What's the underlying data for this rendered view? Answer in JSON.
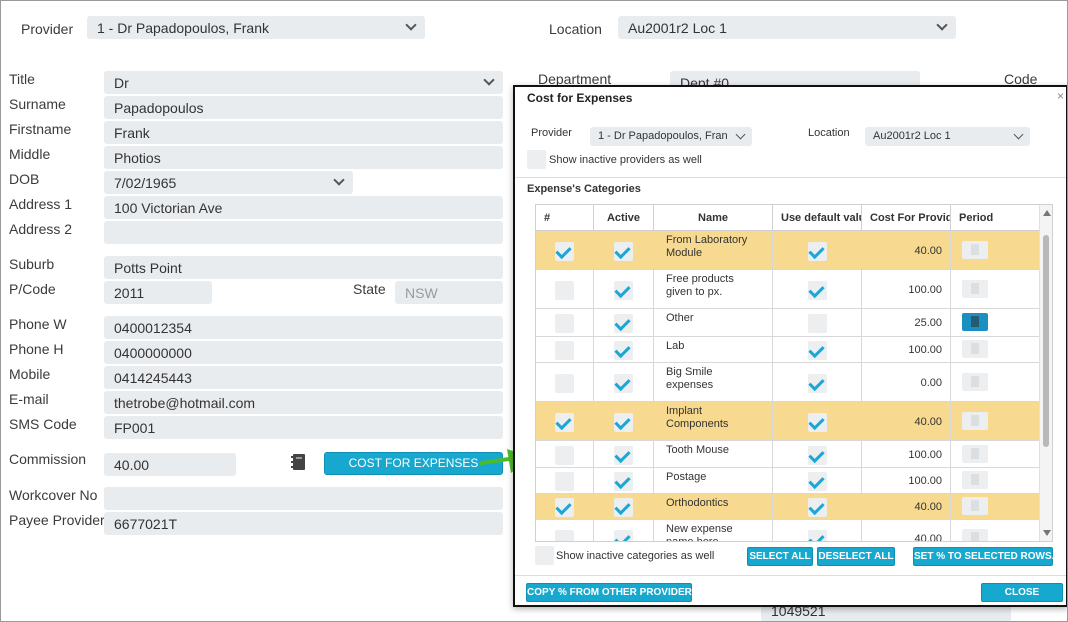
{
  "header": {
    "provider_label": "Provider",
    "provider_value": "1 - Dr Papadopoulos, Frank",
    "location_label": "Location",
    "location_value": "Au2001r2 Loc 1"
  },
  "form": {
    "title_label": "Title",
    "title_value": "Dr",
    "surname_label": "Surname",
    "surname_value": "Papadopoulos",
    "firstname_label": "Firstname",
    "firstname_value": "Frank",
    "middle_label": "Middle",
    "middle_value": "Photios",
    "dob_label": "DOB",
    "dob_value": "7/02/1965",
    "address1_label": "Address 1",
    "address1_value": "100 Victorian Ave",
    "address2_label": "Address 2",
    "address2_value": "",
    "suburb_label": "Suburb",
    "suburb_value": "Potts Point",
    "pcode_label": "P/Code",
    "pcode_value": "2011",
    "state_label": "State",
    "state_value": "NSW",
    "phonew_label": "Phone W",
    "phonew_value": "0400012354",
    "phoneh_label": "Phone H",
    "phoneh_value": "0400000000",
    "mobile_label": "Mobile",
    "mobile_value": "0414245443",
    "email_label": "E-mail",
    "email_value": "thetrobe@hotmail.com",
    "sms_label": "SMS Code",
    "sms_value": "FP001",
    "commission_label": "Commission",
    "commission_value": "40.00",
    "cost_button": "COST FOR EXPENSES",
    "workcover_label": "Workcover No",
    "workcover_value": "",
    "payee_label": "Payee Provider",
    "payee_value": "6677021T"
  },
  "right_bg": {
    "department_label": "Department",
    "department_value": "Dept #0",
    "code_label": "Code",
    "bottom_value": "1049521"
  },
  "modal": {
    "title": "Cost for Expenses",
    "close": "×",
    "provider_label": "Provider",
    "provider_value": "1 - Dr Papadopoulos, Fran",
    "location_label": "Location",
    "location_value": "Au2001r2 Loc 1",
    "show_inactive_providers": "Show inactive providers as well",
    "section_title": "Expense's Categories",
    "columns": [
      "#",
      "Active",
      "Name",
      "Use default valu",
      "Cost For Provid",
      "Period"
    ],
    "rows": [
      {
        "name": "From Laboratory Module",
        "cost": "40.00",
        "selected": true,
        "active": true,
        "use_default": true,
        "highlight": true,
        "period_dark": false
      },
      {
        "name": "Free products given to px.",
        "cost": "100.00",
        "selected": false,
        "active": true,
        "use_default": true,
        "highlight": false,
        "period_dark": false
      },
      {
        "name": "Other",
        "cost": "25.00",
        "selected": false,
        "active": true,
        "use_default": false,
        "highlight": false,
        "period_dark": true
      },
      {
        "name": "Lab",
        "cost": "100.00",
        "selected": false,
        "active": true,
        "use_default": true,
        "highlight": false,
        "period_dark": false
      },
      {
        "name": "Big Smile expenses",
        "cost": "0.00",
        "selected": false,
        "active": true,
        "use_default": true,
        "highlight": false,
        "period_dark": false
      },
      {
        "name": "Implant Components",
        "cost": "40.00",
        "selected": true,
        "active": true,
        "use_default": true,
        "highlight": true,
        "period_dark": false
      },
      {
        "name": "Tooth Mouse",
        "cost": "100.00",
        "selected": false,
        "active": true,
        "use_default": true,
        "highlight": false,
        "period_dark": false
      },
      {
        "name": "Postage",
        "cost": "100.00",
        "selected": false,
        "active": true,
        "use_default": true,
        "highlight": false,
        "period_dark": false
      },
      {
        "name": "Orthodontics",
        "cost": "40.00",
        "selected": true,
        "active": true,
        "use_default": true,
        "highlight": true,
        "period_dark": false
      },
      {
        "name": "New expense name here",
        "cost": "40.00",
        "selected": false,
        "active": true,
        "use_default": true,
        "highlight": false,
        "period_dark": false
      }
    ],
    "show_inactive_categories": "Show inactive categories as well",
    "select_all": "SELECT ALL",
    "deselect_all": "DESELECT ALL",
    "set_percent": "SET % TO SELECTED ROWS...",
    "copy_percent": "COPY % FROM OTHER PROVIDER...",
    "close_button": "CLOSE"
  },
  "colors": {
    "accent": "#17a8d0",
    "highlight_row": "#f7d98f",
    "field_bg": "#e9ecef",
    "arrow": "#4cbb2a"
  }
}
